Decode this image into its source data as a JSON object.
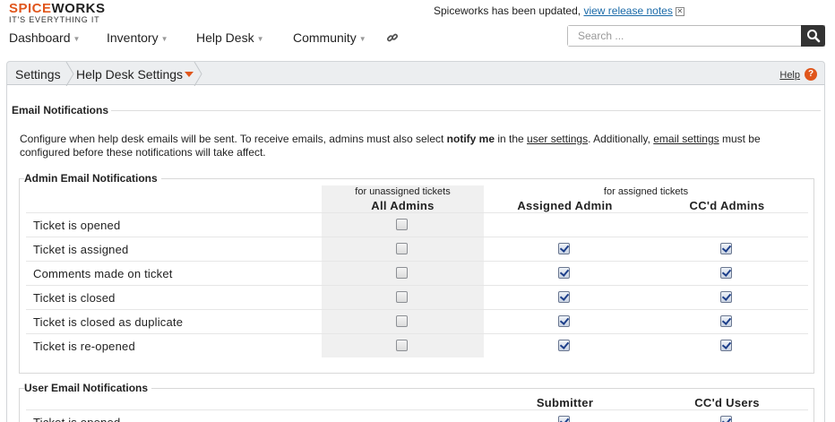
{
  "logo": {
    "spice": "SPICE",
    "works": "WORKS",
    "tagline": "IT'S EVERYTHING IT"
  },
  "update": {
    "message": "Spiceworks has been updated,",
    "link": "view release notes"
  },
  "nav": [
    {
      "label": "Dashboard"
    },
    {
      "label": "Inventory"
    },
    {
      "label": "Help Desk"
    },
    {
      "label": "Community"
    }
  ],
  "search": {
    "placeholder": "Search ..."
  },
  "breadcrumb": {
    "root": "Settings",
    "current": "Help Desk Settings"
  },
  "help": {
    "label": "Help",
    "icon": "?"
  },
  "email_notifications": {
    "title": "Email Notifications",
    "desc_part1": "Configure when help desk emails will be sent. To receive emails, admins must also select ",
    "desc_bold": "notify me",
    "desc_part2": " in the ",
    "desc_link1": "user settings",
    "desc_part3": ". Additionally, ",
    "desc_link2": "email settings",
    "desc_part4": " must be configured before these notifications will take affect."
  },
  "admin_section": {
    "legend": "Admin Email Notifications",
    "unassigned_label": "for unassigned tickets",
    "assigned_label": "for assigned tickets",
    "columns": [
      "All Admins",
      "Assigned Admin",
      "CC'd Admins"
    ],
    "rows": [
      {
        "label": "Ticket is opened",
        "values": [
          false,
          null,
          null
        ]
      },
      {
        "label": "Ticket is assigned",
        "values": [
          false,
          true,
          true
        ]
      },
      {
        "label": "Comments made on ticket",
        "values": [
          false,
          true,
          true
        ]
      },
      {
        "label": "Ticket is closed",
        "values": [
          false,
          true,
          true
        ]
      },
      {
        "label": "Ticket is closed as duplicate",
        "values": [
          false,
          true,
          true
        ]
      },
      {
        "label": "Ticket is re-opened",
        "values": [
          false,
          true,
          true
        ]
      }
    ]
  },
  "user_section": {
    "legend": "User Email Notifications",
    "columns": [
      "Submitter",
      "CC'd Users"
    ],
    "rows": [
      {
        "label": "Ticket is opened",
        "values": [
          true,
          true
        ]
      }
    ]
  },
  "colors": {
    "accent": "#e0561c",
    "link": "#1a6aa8",
    "checkmark": "#1d3f8a"
  }
}
